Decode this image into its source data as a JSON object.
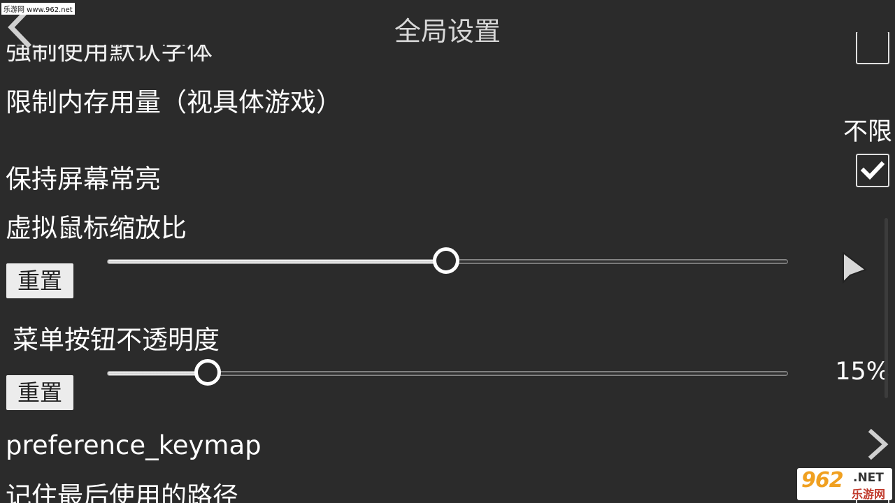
{
  "watermark": {
    "site_text": "乐游网 www.962.net",
    "logo_number": "962",
    "logo_net": ".NET",
    "logo_cn": "乐游网"
  },
  "header": {
    "title": "全局设置",
    "back_icon": "chevron-left-icon"
  },
  "settings": {
    "partial_top_label": "强制使用默认字体",
    "memory_limit": {
      "label": "限制内存用量（视具体游戏）",
      "value": "不限"
    },
    "keep_screen_on": {
      "label": "保持屏幕常亮",
      "checked": true
    },
    "mouse_scale": {
      "label": "虚拟鼠标缩放比",
      "reset_label": "重置",
      "slider_value": 0.5,
      "preview_icon": "mouse-pointer-icon"
    },
    "button_opacity": {
      "label": "菜单按钮不透明度",
      "reset_label": "重置",
      "slider_value": 0.15,
      "value_text": "15%"
    },
    "keymap": {
      "label": "preference_keymap",
      "icon": "chevron-right-icon"
    },
    "remember_path": {
      "label": "记住最后使用的路径"
    }
  }
}
